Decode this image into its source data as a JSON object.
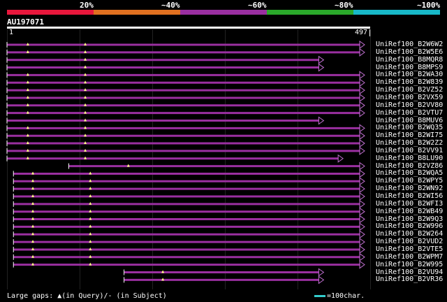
{
  "header": {
    "percent_labels": [
      "20%",
      "~40%",
      "~60%",
      "~80%",
      "~100%"
    ],
    "segments": [
      {
        "color": "#e8173c"
      },
      {
        "color": "#e07020"
      },
      {
        "color": "#9a2fa0"
      },
      {
        "color": "#2aa82a"
      },
      {
        "color": "#18b8c8"
      }
    ]
  },
  "query": {
    "id": "AU197071",
    "start": "1",
    "end": "497",
    "length": 497
  },
  "colors": {
    "hit": "#9a2fa0",
    "gap": "#ffff80",
    "arrow": "#c070d0"
  },
  "hits": [
    {
      "id": "UniRef100_B2W6W2",
      "start": 1,
      "end": 497,
      "arrow": true,
      "gaps": [
        30,
        110
      ]
    },
    {
      "id": "UniRef100_B2W5E6",
      "start": 1,
      "end": 497,
      "arrow": true,
      "gaps": [
        30,
        110
      ]
    },
    {
      "id": "UniRef100_B8MQR8",
      "start": 1,
      "end": 440,
      "arrow": true,
      "gaps": [
        110
      ]
    },
    {
      "id": "UniRef100_B8MPS9",
      "start": 1,
      "end": 440,
      "arrow": true,
      "gaps": [
        110
      ]
    },
    {
      "id": "UniRef100_B2WA30",
      "start": 1,
      "end": 497,
      "arrow": true,
      "gaps": [
        30,
        110
      ]
    },
    {
      "id": "UniRef100_B2W839",
      "start": 1,
      "end": 497,
      "arrow": true,
      "gaps": [
        30,
        110
      ]
    },
    {
      "id": "UniRef100_B2VZ52",
      "start": 1,
      "end": 497,
      "arrow": true,
      "gaps": [
        30,
        110
      ]
    },
    {
      "id": "UniRef100_B2VX59",
      "start": 1,
      "end": 497,
      "arrow": true,
      "gaps": [
        30,
        110
      ]
    },
    {
      "id": "UniRef100_B2VV80",
      "start": 1,
      "end": 497,
      "arrow": true,
      "gaps": [
        30,
        110
      ]
    },
    {
      "id": "UniRef100_B2VTU7",
      "start": 1,
      "end": 497,
      "arrow": true,
      "gaps": [
        30,
        110
      ]
    },
    {
      "id": "UniRef100_B8MUV6",
      "start": 1,
      "end": 440,
      "arrow": true,
      "gaps": [
        110
      ]
    },
    {
      "id": "UniRef100_B2WQ35",
      "start": 1,
      "end": 497,
      "arrow": true,
      "gaps": [
        30,
        110
      ]
    },
    {
      "id": "UniRef100_B2WI75",
      "start": 1,
      "end": 497,
      "arrow": true,
      "gaps": [
        30,
        110
      ]
    },
    {
      "id": "UniRef100_B2W2Z2",
      "start": 1,
      "end": 497,
      "arrow": true,
      "gaps": [
        30,
        110
      ]
    },
    {
      "id": "UniRef100_B2VV91",
      "start": 1,
      "end": 497,
      "arrow": true,
      "gaps": [
        30,
        110
      ]
    },
    {
      "id": "UniRef100_B8LU90",
      "start": 1,
      "end": 467,
      "arrow": true,
      "gaps": [
        30,
        110
      ]
    },
    {
      "id": "UniRef100_B2VZ86",
      "start": 87,
      "end": 497,
      "arrow": true,
      "gaps": [
        170
      ]
    },
    {
      "id": "UniRef100_B2WQA5",
      "start": 10,
      "end": 497,
      "arrow": true,
      "gaps": [
        37,
        117
      ]
    },
    {
      "id": "UniRef100_B2WPY5",
      "start": 10,
      "end": 497,
      "arrow": true,
      "gaps": [
        37,
        117
      ]
    },
    {
      "id": "UniRef100_B2WN92",
      "start": 10,
      "end": 497,
      "arrow": true,
      "gaps": [
        37,
        117
      ]
    },
    {
      "id": "UniRef100_B2WI56",
      "start": 10,
      "end": 497,
      "arrow": true,
      "gaps": [
        37,
        117
      ]
    },
    {
      "id": "UniRef100_B2WFI3",
      "start": 10,
      "end": 497,
      "arrow": true,
      "gaps": [
        37,
        117
      ]
    },
    {
      "id": "UniRef100_B2WB49",
      "start": 10,
      "end": 497,
      "arrow": true,
      "gaps": [
        37,
        117
      ]
    },
    {
      "id": "UniRef100_B2W9Q3",
      "start": 10,
      "end": 497,
      "arrow": true,
      "gaps": [
        37,
        117
      ]
    },
    {
      "id": "UniRef100_B2W996",
      "start": 10,
      "end": 497,
      "arrow": true,
      "gaps": [
        37,
        117
      ]
    },
    {
      "id": "UniRef100_B2W264",
      "start": 10,
      "end": 497,
      "arrow": true,
      "gaps": [
        37,
        117
      ]
    },
    {
      "id": "UniRef100_B2VUD2",
      "start": 10,
      "end": 497,
      "arrow": true,
      "gaps": [
        37,
        117
      ]
    },
    {
      "id": "UniRef100_B2VTE5",
      "start": 10,
      "end": 497,
      "arrow": true,
      "gaps": [
        37,
        117
      ]
    },
    {
      "id": "UniRef100_B2WPM7",
      "start": 10,
      "end": 497,
      "arrow": true,
      "gaps": [
        37,
        117
      ]
    },
    {
      "id": "UniRef100_B2W995",
      "start": 10,
      "end": 497,
      "arrow": true,
      "gaps": [
        37,
        117
      ]
    },
    {
      "id": "UniRef100_B2VU94",
      "start": 164,
      "end": 440,
      "arrow": true,
      "gaps": [
        218
      ]
    },
    {
      "id": "UniRef100_B2VR36",
      "start": 164,
      "end": 440,
      "arrow": true,
      "gaps": [
        218
      ]
    }
  ],
  "legend": {
    "text": "Large gaps: ▲(in Query)/- (in Subject)",
    "scale_text": "=100char."
  }
}
